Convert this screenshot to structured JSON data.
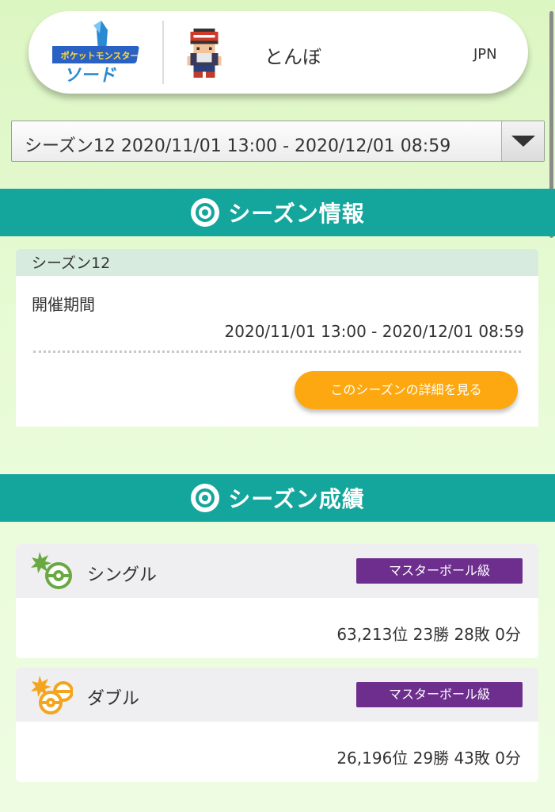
{
  "profile": {
    "logo_text": "ポケットモンスター ソード",
    "trainer_name": "とんぼ",
    "region": "JPN"
  },
  "season_select": {
    "selected": "シーズン12 2020/11/01 13:00 - 2020/12/01 08:59"
  },
  "season_info": {
    "header": "シーズン情報",
    "season_label": "シーズン12",
    "period_label": "開催期間",
    "period_value": "2020/11/01 13:00 - 2020/12/01 08:59",
    "detail_button": "このシーズンの詳細を見る"
  },
  "season_results": {
    "header": "シーズン成績",
    "modes": [
      {
        "label": "シングル",
        "rank_class": "マスターボール級",
        "record": "63,213位 23勝 28敗 0分"
      },
      {
        "label": "ダブル",
        "rank_class": "マスターボール級",
        "record": "26,196位 29勝 43敗 0分"
      }
    ]
  },
  "colors": {
    "header_teal": "#14a69c",
    "button_orange": "#fda811",
    "badge_purple": "#6d2e8e",
    "single_icon_green": "#6aa842",
    "double_icon_orange": "#f3a51d"
  },
  "icons": {
    "section_icon": "poke-ball-icon",
    "single_icon": "single-battle-icon",
    "double_icon": "double-battle-icon",
    "dropdown_icon": "triangle-down-icon"
  }
}
